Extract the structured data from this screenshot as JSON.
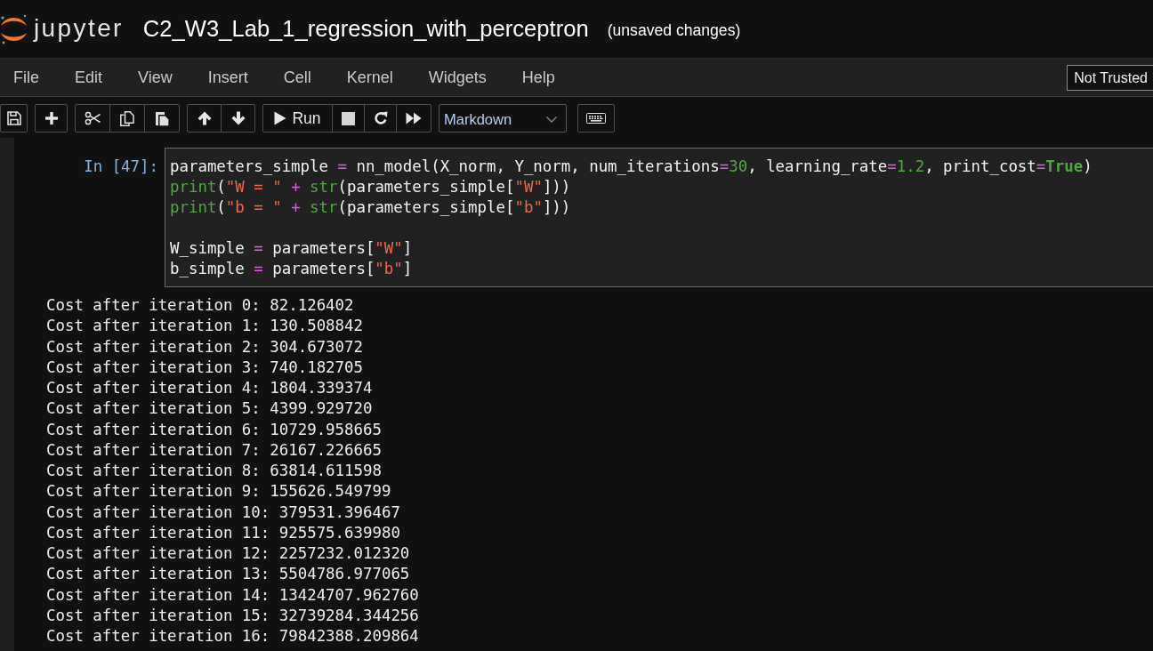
{
  "header": {
    "logo_text": "jupyter",
    "notebook_title": "C2_W3_Lab_1_regression_with_perceptron",
    "save_status": "(unsaved changes)"
  },
  "menu": {
    "items": [
      "File",
      "Edit",
      "View",
      "Insert",
      "Cell",
      "Kernel",
      "Widgets",
      "Help"
    ],
    "trust_button": "Not Trusted"
  },
  "toolbar": {
    "run_button": "Run",
    "cell_type_select": "Markdown"
  },
  "cell": {
    "prompt": "In [47]:",
    "code_lines": [
      {
        "kind": "code",
        "tokens": [
          {
            "kind": "plain",
            "text": "parameters_simple "
          },
          {
            "kind": "operator",
            "text": "="
          },
          {
            "kind": "plain",
            "text": " nn_model(X_norm, Y_norm, num_iterations"
          },
          {
            "kind": "operator",
            "text": "="
          },
          {
            "kind": "number",
            "text": "30"
          },
          {
            "kind": "plain",
            "text": ", learning_rate"
          },
          {
            "kind": "operator",
            "text": "="
          },
          {
            "kind": "number",
            "text": "1.2"
          },
          {
            "kind": "plain",
            "text": ", print_cost"
          },
          {
            "kind": "operator",
            "text": "="
          },
          {
            "kind": "keyword",
            "text": "True"
          },
          {
            "kind": "plain",
            "text": ")"
          }
        ]
      },
      {
        "kind": "code",
        "tokens": [
          {
            "kind": "builtin",
            "text": "print"
          },
          {
            "kind": "plain",
            "text": "("
          },
          {
            "kind": "string",
            "text": "\"W = \""
          },
          {
            "kind": "operator",
            "text": " + "
          },
          {
            "kind": "builtin",
            "text": "str"
          },
          {
            "kind": "plain",
            "text": "(parameters_simple["
          },
          {
            "kind": "string",
            "text": "\"W\""
          },
          {
            "kind": "plain",
            "text": "]))"
          }
        ]
      },
      {
        "kind": "code",
        "tokens": [
          {
            "kind": "builtin",
            "text": "print"
          },
          {
            "kind": "plain",
            "text": "("
          },
          {
            "kind": "string",
            "text": "\"b = \""
          },
          {
            "kind": "operator",
            "text": " + "
          },
          {
            "kind": "builtin",
            "text": "str"
          },
          {
            "kind": "plain",
            "text": "(parameters_simple["
          },
          {
            "kind": "string",
            "text": "\"b\""
          },
          {
            "kind": "plain",
            "text": "]))"
          }
        ]
      },
      {
        "kind": "blank"
      },
      {
        "kind": "code",
        "tokens": [
          {
            "kind": "plain",
            "text": "W_simple "
          },
          {
            "kind": "operator",
            "text": "="
          },
          {
            "kind": "plain",
            "text": " parameters["
          },
          {
            "kind": "string",
            "text": "\"W\""
          },
          {
            "kind": "plain",
            "text": "]"
          }
        ]
      },
      {
        "kind": "code",
        "tokens": [
          {
            "kind": "plain",
            "text": "b_simple "
          },
          {
            "kind": "operator",
            "text": "="
          },
          {
            "kind": "plain",
            "text": " parameters["
          },
          {
            "kind": "string",
            "text": "\"b\""
          },
          {
            "kind": "plain",
            "text": "]"
          }
        ]
      }
    ],
    "output_lines": [
      "Cost after iteration 0: 82.126402",
      "Cost after iteration 1: 130.508842",
      "Cost after iteration 2: 304.673072",
      "Cost after iteration 3: 740.182705",
      "Cost after iteration 4: 1804.339374",
      "Cost after iteration 5: 4399.929720",
      "Cost after iteration 6: 10729.958665",
      "Cost after iteration 7: 26167.226665",
      "Cost after iteration 8: 63814.611598",
      "Cost after iteration 9: 155626.549799",
      "Cost after iteration 10: 379531.396467",
      "Cost after iteration 11: 925575.639980",
      "Cost after iteration 12: 2257232.012320",
      "Cost after iteration 13: 5504786.977065",
      "Cost after iteration 14: 13424707.962760",
      "Cost after iteration 15: 32739284.344256",
      "Cost after iteration 16: 79842388.209864"
    ]
  }
}
